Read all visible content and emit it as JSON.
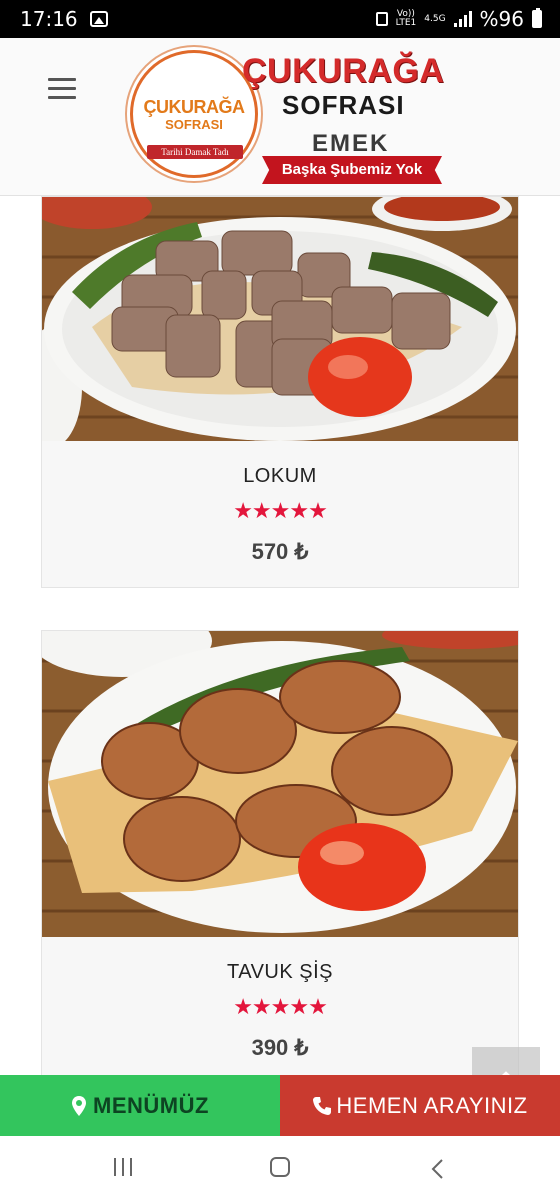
{
  "status_bar": {
    "time": "17:16",
    "network_top": "Vo))",
    "network_bottom": "LTE1",
    "network_type": "4.5G",
    "battery": "%96"
  },
  "header": {
    "logo": {
      "circle_line1": "ÇUKURAĞA",
      "circle_line2": "SOFRASI",
      "circle_tagline": "Tarihi Damak Tadı",
      "title_line1": "ÇUKURAĞA",
      "title_line2": "SOFRASI",
      "branch": "EMEK",
      "banner": "Başka Şubemiz Yok"
    }
  },
  "products": [
    {
      "name": "LOKUM",
      "rating": 5,
      "stars": "★★★★★",
      "price": "570 ₺"
    },
    {
      "name": "TAVUK ŞİŞ",
      "rating": 5,
      "stars": "★★★★★",
      "price": "390 ₺"
    }
  ],
  "actions": {
    "menu_label": "MENÜMÜZ",
    "call_label": "HEMEN ARAYINIZ"
  },
  "colors": {
    "menu_button": "#33c55d",
    "call_button": "#c93a2f",
    "stars": "#e3163c",
    "brand_red": "#d42a2a"
  },
  "icons": [
    "hamburger-icon",
    "map-pin-icon",
    "phone-icon",
    "chevron-up-icon",
    "recents-icon",
    "home-icon",
    "back-icon"
  ]
}
